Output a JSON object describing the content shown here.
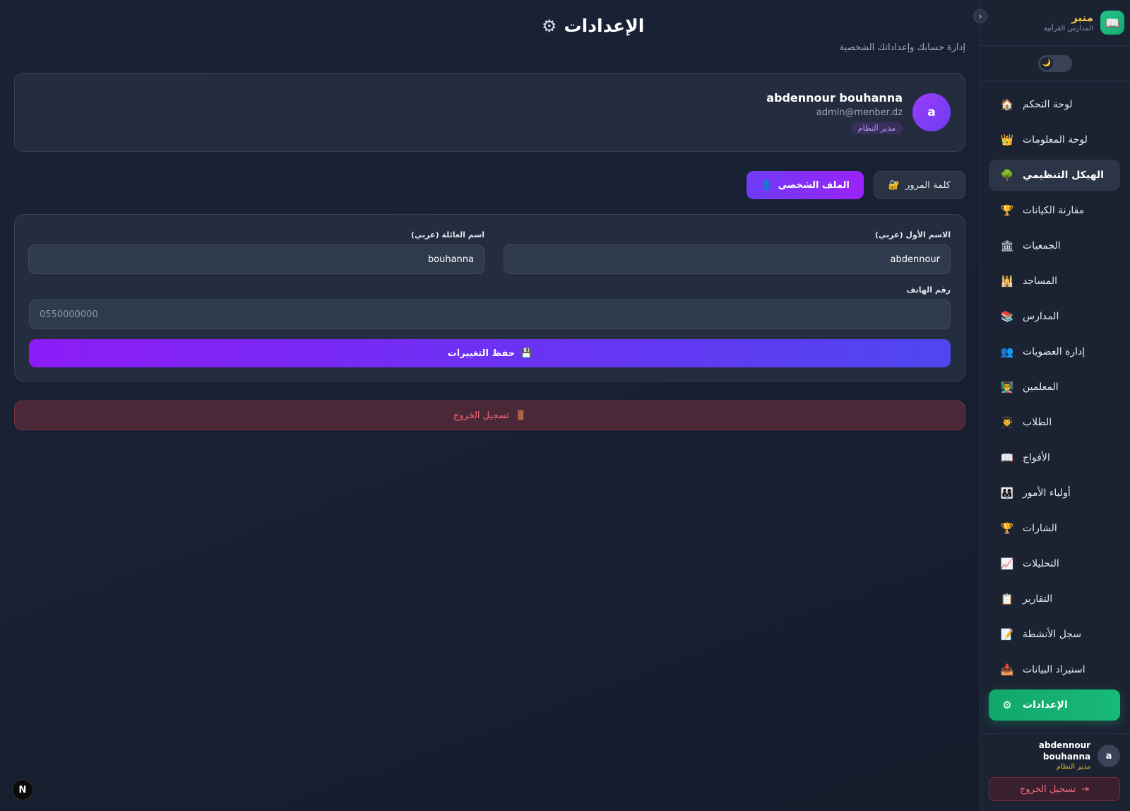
{
  "sidebar": {
    "brand_name": "منبر",
    "brand_subtitle": "المدارس القرآنية",
    "brand_icon": "📖",
    "collapse_icon": "›",
    "theme_icon": "🌙",
    "items": [
      {
        "label": "لوحة التحكم",
        "icon": "🏠",
        "state": "normal"
      },
      {
        "label": "لوحة المعلومات",
        "icon": "👑",
        "state": "normal"
      },
      {
        "label": "الهيكل التنظيمي",
        "icon": "🌳",
        "state": "hover"
      },
      {
        "label": "مقارنة الكيانات",
        "icon": "🏆",
        "state": "normal"
      },
      {
        "label": "الجمعيات",
        "icon": "🏛",
        "state": "normal"
      },
      {
        "label": "المساجد",
        "icon": "🕌",
        "state": "normal"
      },
      {
        "label": "المدارس",
        "icon": "📚",
        "state": "normal"
      },
      {
        "label": "إدارة العضويات",
        "icon": "👥",
        "state": "normal"
      },
      {
        "label": "المعلمين",
        "icon": "👨‍🏫",
        "state": "normal"
      },
      {
        "label": "الطلاب",
        "icon": "👨‍🎓",
        "state": "normal"
      },
      {
        "label": "الأفواج",
        "icon": "📖",
        "state": "normal"
      },
      {
        "label": "أولياء الأمور",
        "icon": "👨‍👩‍👧",
        "state": "normal"
      },
      {
        "label": "الشارات",
        "icon": "🏆",
        "state": "normal"
      },
      {
        "label": "التحليلات",
        "icon": "📈",
        "state": "normal"
      },
      {
        "label": "التقارير",
        "icon": "📋",
        "state": "normal"
      },
      {
        "label": "سجل الأنشطة",
        "icon": "📝",
        "state": "normal"
      },
      {
        "label": "استيراد البيانات",
        "icon": "📥",
        "state": "normal"
      },
      {
        "label": "الإعدادات",
        "icon": "⚙",
        "state": "active"
      }
    ],
    "user": {
      "avatar_letter": "a",
      "name": "abdennour bouhanna",
      "role": "مدير النظام"
    },
    "logout_label": "تسجيل الخروج",
    "logout_icon": "⇥"
  },
  "header": {
    "title": "الإعدادات",
    "title_icon": "⚙",
    "subtitle": "إدارة حسابك وإعداداتك الشخصية"
  },
  "profile": {
    "avatar_letter": "a",
    "name": "abdennour bouhanna",
    "email": "admin@menber.dz",
    "role": "مدير النظام"
  },
  "tabs": [
    {
      "label": "الملف الشخصي",
      "icon": "👤",
      "active": true
    },
    {
      "label": "كلمة المرور",
      "icon": "🔐",
      "active": false
    }
  ],
  "form": {
    "first_name_label": "الاسم الأول (عربي)",
    "first_name_value": "abdennour",
    "last_name_label": "اسم العائلة (عربي)",
    "last_name_value": "bouhanna",
    "phone_label": "رقم الهاتف",
    "phone_placeholder": "0550000000",
    "save_label": "حفظ التغييرات",
    "save_icon": "💾"
  },
  "logout": {
    "label": "تسجيل الخروج",
    "icon": "🚪"
  },
  "dev_badge": "N",
  "colors": {
    "accent_green": "#10a86a",
    "accent_purple": "#8c1cf7",
    "brand_gold": "#f5c542",
    "danger": "#f26a78"
  }
}
